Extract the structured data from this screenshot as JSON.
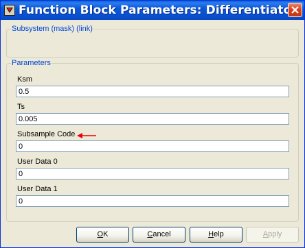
{
  "window": {
    "title": "Function Block Parameters: Differentiator"
  },
  "subsystem_group": {
    "label": "Subsystem (mask) (link)"
  },
  "parameters_group": {
    "label": "Parameters"
  },
  "params": [
    {
      "label": "Ksm",
      "value": "0.5"
    },
    {
      "label": "Ts",
      "value": "0.005"
    },
    {
      "label": "Subsample Code",
      "value": "0"
    },
    {
      "label": "User Data 0",
      "value": "0"
    },
    {
      "label": "User Data 1",
      "value": "0"
    }
  ],
  "buttons": {
    "ok": {
      "mnemonic": "O",
      "rest": "K"
    },
    "cancel": {
      "mnemonic": "C",
      "rest": "ancel"
    },
    "help": {
      "mnemonic": "H",
      "rest": "elp"
    },
    "apply": {
      "mnemonic": "A",
      "rest": "pply"
    }
  },
  "annotation": {
    "arrow_color": "#e8000b"
  }
}
